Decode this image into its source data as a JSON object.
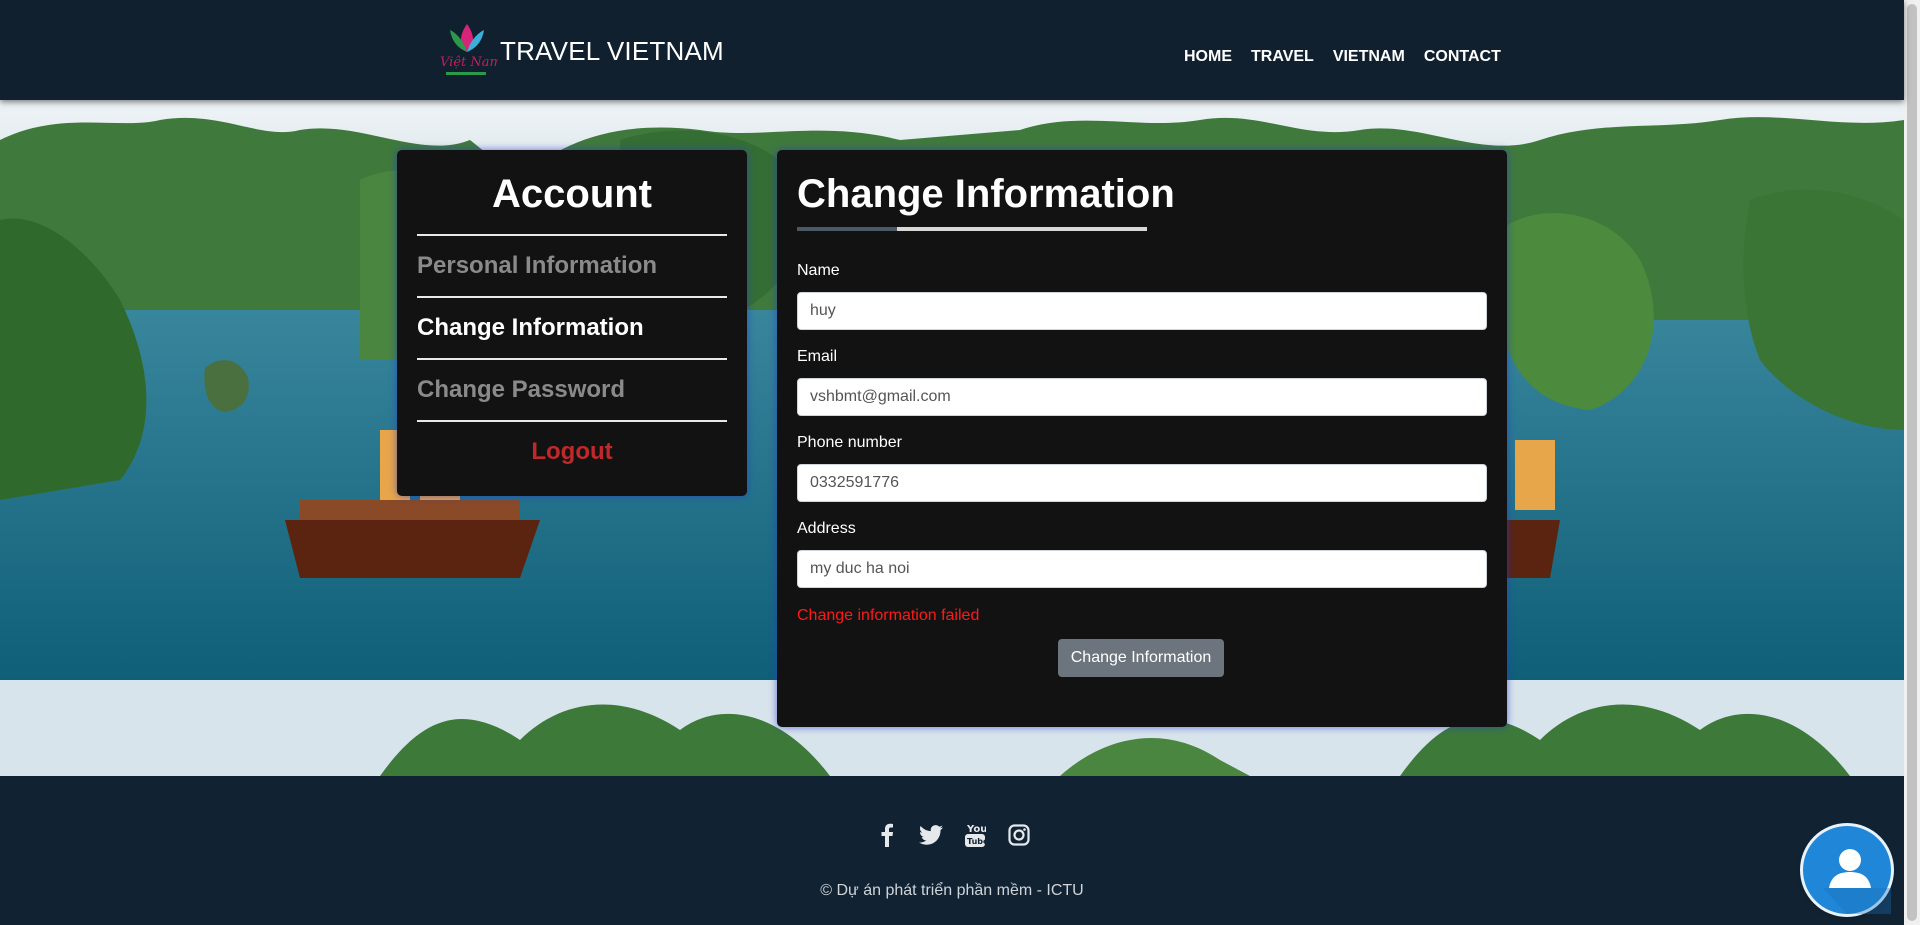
{
  "header": {
    "logo_text": "Việt Nam",
    "title": "TRAVEL VIETNAM",
    "nav": [
      "HOME",
      "TRAVEL",
      "VIETNAM",
      "CONTACT"
    ]
  },
  "sidebar": {
    "title": "Account",
    "items": [
      {
        "label": "Personal Information",
        "active": false
      },
      {
        "label": "Change Information",
        "active": true
      },
      {
        "label": "Change Password",
        "active": false
      },
      {
        "label": "Logout",
        "active": false
      }
    ]
  },
  "form": {
    "title": "Change Information",
    "fields": [
      {
        "label": "Name",
        "value": "huy"
      },
      {
        "label": "Email",
        "value": "vshbmt@gmail.com"
      },
      {
        "label": "Phone number",
        "value": "0332591776"
      },
      {
        "label": "Address",
        "value": "my duc ha noi"
      }
    ],
    "error": "Change information failed",
    "submit_label": "Change Information"
  },
  "footer": {
    "social_icons": [
      "facebook-icon",
      "twitter-icon",
      "youtube-icon",
      "instagram-icon"
    ],
    "copyright": "© Dự án phát triển phần mềm - ICTU"
  },
  "colors": {
    "header_bg": "#10202f",
    "card_bg": "#121212",
    "error": "#ff1a1a",
    "logout": "#c0282a",
    "button": "#6c757d",
    "chat": "#1f86d8"
  }
}
